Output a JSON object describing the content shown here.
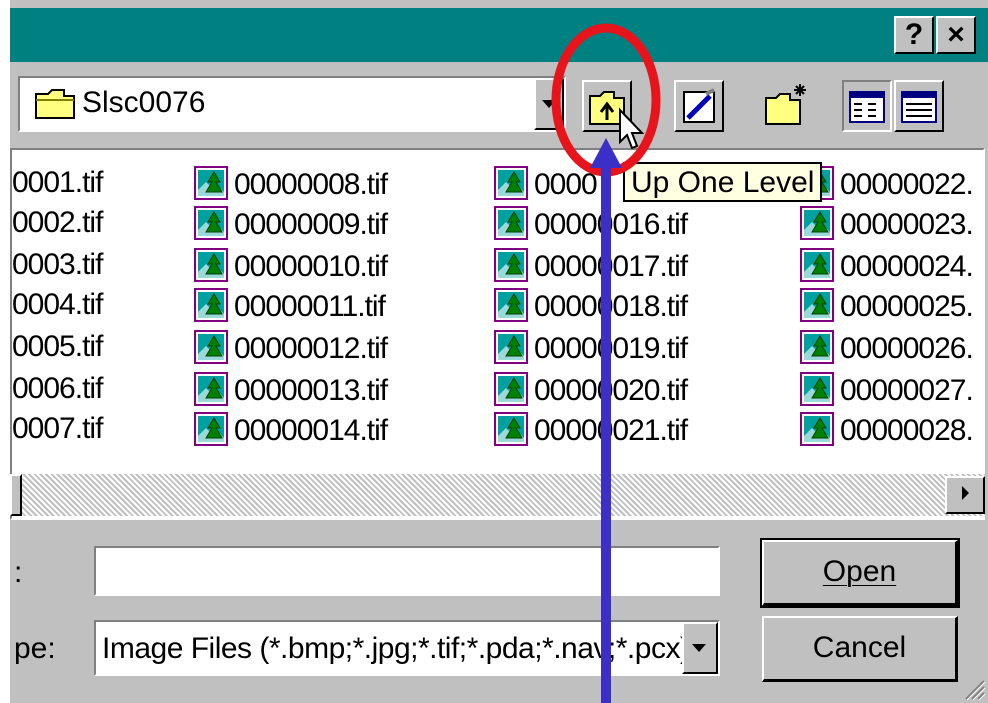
{
  "titlebar": {
    "help_label": "?",
    "close_label": "×"
  },
  "look_in": {
    "value": "Slsc0076"
  },
  "toolbar": {
    "up_one_level_icon": "folder-up-icon",
    "desktop_icon": "desktop-icon",
    "new_folder_icon": "new-folder-icon",
    "list_view_icon": "list-view-icon",
    "details_view_icon": "details-view-icon",
    "tooltip": "Up One Level"
  },
  "files": {
    "col1": [
      "0001.tif",
      "0002.tif",
      "0003.tif",
      "0004.tif",
      "0005.tif",
      "0006.tif",
      "0007.tif"
    ],
    "col2": [
      "00000008.tif",
      "00000009.tif",
      "00000010.tif",
      "00000011.tif",
      "00000012.tif",
      "00000013.tif",
      "00000014.tif"
    ],
    "col3": [
      "0000",
      "00000016.tif",
      "00000017.tif",
      "00000018.tif",
      "00000019.tif",
      "00000020.tif",
      "00000021.tif"
    ],
    "col4": [
      "00000022.",
      "00000023.",
      "00000024.",
      "00000025.",
      "00000026.",
      "00000027.",
      "00000028."
    ]
  },
  "form": {
    "filename_label": ":",
    "filename_value": "",
    "filetype_label": "pe:",
    "filetype_value": "Image Files (*.bmp;*.jpg;*.tif;*.pda;*.nav;*.pcx)"
  },
  "buttons": {
    "open_label": "Open",
    "cancel_label": "Cancel"
  },
  "annotations": {
    "highlight_color": "#e8141c",
    "arrow_color": "#3a30c8"
  },
  "colors": {
    "titlebar": "#008080",
    "dialog_face": "#c0c0c0",
    "tooltip_bg": "#ffffe1"
  }
}
